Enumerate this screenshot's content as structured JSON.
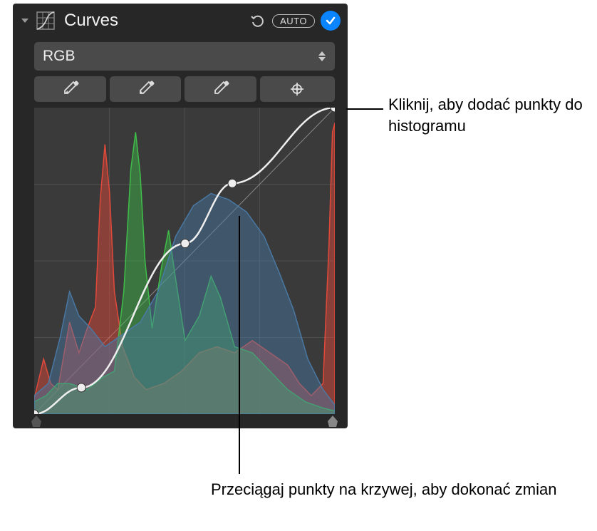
{
  "header": {
    "title": "Curves",
    "auto_label": "AUTO"
  },
  "dropdown": {
    "selected": "RGB"
  },
  "callouts": {
    "add_points": "Kliknij, aby dodać punkty do histogramu",
    "drag_points": "Przeciągaj punkty na krzywej, aby dokonać zmian"
  },
  "chart_data": {
    "type": "area",
    "title": "RGB Histogram with Curve",
    "xlim": [
      0,
      255
    ],
    "ylim": [
      0,
      100
    ],
    "series": [
      {
        "name": "Red",
        "color": "#e84a3a",
        "values": [
          [
            0,
            5
          ],
          [
            8,
            18
          ],
          [
            14,
            10
          ],
          [
            20,
            8
          ],
          [
            30,
            30
          ],
          [
            38,
            20
          ],
          [
            45,
            28
          ],
          [
            52,
            35
          ],
          [
            56,
            70
          ],
          [
            60,
            88
          ],
          [
            64,
            72
          ],
          [
            68,
            40
          ],
          [
            75,
            22
          ],
          [
            85,
            12
          ],
          [
            95,
            8
          ],
          [
            110,
            10
          ],
          [
            125,
            14
          ],
          [
            140,
            20
          ],
          [
            155,
            22
          ],
          [
            170,
            20
          ],
          [
            185,
            24
          ],
          [
            200,
            20
          ],
          [
            215,
            16
          ],
          [
            225,
            10
          ],
          [
            235,
            6
          ],
          [
            245,
            10
          ],
          [
            250,
            55
          ],
          [
            253,
            92
          ],
          [
            255,
            95
          ]
        ]
      },
      {
        "name": "Green",
        "color": "#3fc24a",
        "values": [
          [
            0,
            4
          ],
          [
            10,
            6
          ],
          [
            20,
            10
          ],
          [
            30,
            10
          ],
          [
            45,
            8
          ],
          [
            58,
            12
          ],
          [
            68,
            14
          ],
          [
            76,
            40
          ],
          [
            82,
            80
          ],
          [
            86,
            92
          ],
          [
            90,
            78
          ],
          [
            94,
            50
          ],
          [
            100,
            28
          ],
          [
            108,
            48
          ],
          [
            114,
            60
          ],
          [
            120,
            44
          ],
          [
            128,
            24
          ],
          [
            140,
            32
          ],
          [
            150,
            45
          ],
          [
            158,
            38
          ],
          [
            170,
            22
          ],
          [
            185,
            20
          ],
          [
            200,
            14
          ],
          [
            215,
            8
          ],
          [
            230,
            4
          ],
          [
            245,
            2
          ],
          [
            255,
            1
          ]
        ]
      },
      {
        "name": "Blue",
        "color": "#4a7aa8",
        "values": [
          [
            0,
            6
          ],
          [
            12,
            10
          ],
          [
            22,
            25
          ],
          [
            30,
            40
          ],
          [
            38,
            32
          ],
          [
            48,
            28
          ],
          [
            60,
            22
          ],
          [
            75,
            26
          ],
          [
            90,
            30
          ],
          [
            105,
            40
          ],
          [
            120,
            58
          ],
          [
            135,
            68
          ],
          [
            150,
            72
          ],
          [
            165,
            70
          ],
          [
            180,
            66
          ],
          [
            195,
            58
          ],
          [
            208,
            46
          ],
          [
            220,
            34
          ],
          [
            232,
            18
          ],
          [
            245,
            8
          ],
          [
            255,
            3
          ]
        ]
      }
    ],
    "curve_points": [
      {
        "x": 0,
        "y": 0
      },
      {
        "x": 40,
        "y": 22
      },
      {
        "x": 128,
        "y": 142
      },
      {
        "x": 168,
        "y": 192
      },
      {
        "x": 255,
        "y": 255
      }
    ]
  }
}
